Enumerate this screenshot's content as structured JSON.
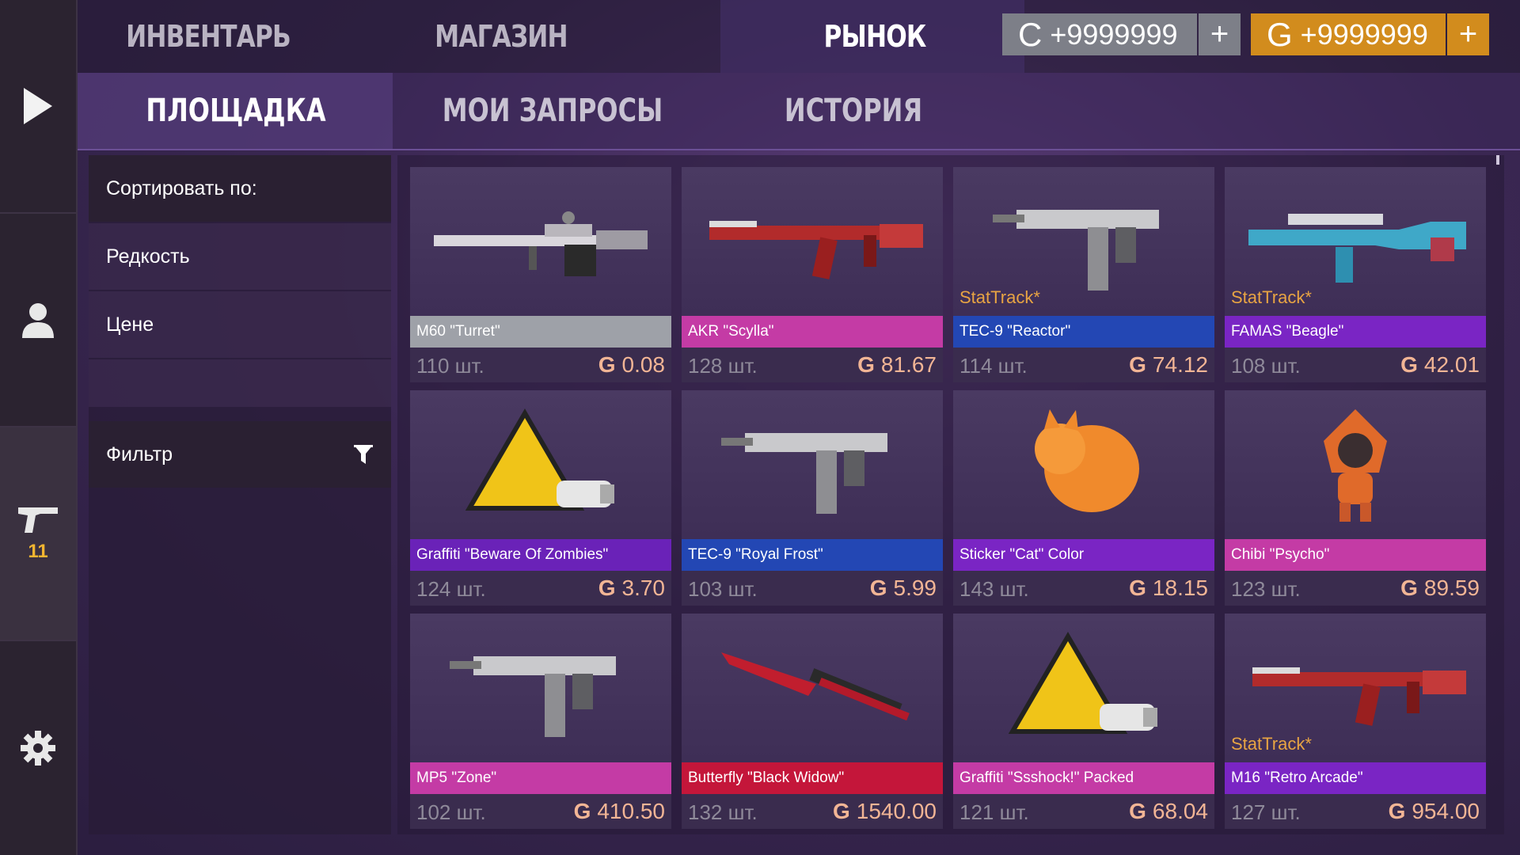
{
  "rail": {
    "weapon_count": "11"
  },
  "top_tabs": [
    {
      "label": "ИНВЕНТАРЬ"
    },
    {
      "label": "МАГАЗИН"
    },
    {
      "label": "РЫНОК"
    }
  ],
  "currency": {
    "credits": {
      "symbol": "C",
      "amount": "+9999999",
      "plus": "+",
      "color": "#7d7f88"
    },
    "gold": {
      "symbol": "G",
      "amount": "+9999999",
      "plus": "+",
      "color": "#d28c1d"
    }
  },
  "sub_tabs": [
    {
      "label": "ПЛОЩАДКА"
    },
    {
      "label": "МОИ ЗАПРОСЫ"
    },
    {
      "label": "ИСТОРИЯ"
    }
  ],
  "sort": {
    "header": "Сортировать по:",
    "options": [
      "Редкость",
      "Цене"
    ],
    "filter_label": "Фильтр"
  },
  "items": [
    {
      "name": "M60 \"Turret\"",
      "qty": "110 шт.",
      "currency": "G",
      "price": "0.08",
      "stattrak": "",
      "rarity_color": "#9ea1a8",
      "icon": "machine-gun-icon"
    },
    {
      "name": "AKR \"Scylla\"",
      "qty": "128 шт.",
      "currency": "G",
      "price": "81.67",
      "stattrak": "",
      "rarity_color": "#c43ba5",
      "icon": "rifle-icon"
    },
    {
      "name": "TEC-9 \"Reactor\"",
      "qty": "114 шт.",
      "currency": "G",
      "price": "74.12",
      "stattrak": "StatTrack*",
      "rarity_color": "#2347b4",
      "icon": "smg-icon"
    },
    {
      "name": "FAMAS \"Beagle\"",
      "qty": "108 шт.",
      "currency": "G",
      "price": "42.01",
      "stattrak": "StatTrack*",
      "rarity_color": "#7a25c4",
      "icon": "bullpup-rifle-icon"
    },
    {
      "name": "Graffiti \"Beware Of Zombies\"",
      "qty": "124 шт.",
      "currency": "G",
      "price": "3.70",
      "stattrak": "",
      "rarity_color": "#6a22b8",
      "icon": "graffiti-icon"
    },
    {
      "name": "TEC-9 \"Royal Frost\"",
      "qty": "103 шт.",
      "currency": "G",
      "price": "5.99",
      "stattrak": "",
      "rarity_color": "#2347b4",
      "icon": "smg-icon"
    },
    {
      "name": "Sticker \"Cat\" Color",
      "qty": "143 шт.",
      "currency": "G",
      "price": "18.15",
      "stattrak": "",
      "rarity_color": "#7a25c4",
      "icon": "sticker-icon"
    },
    {
      "name": "Chibi \"Psycho\"",
      "qty": "123 шт.",
      "currency": "G",
      "price": "89.59",
      "stattrak": "",
      "rarity_color": "#c43ba5",
      "icon": "chibi-figure-icon"
    },
    {
      "name": "MP5 \"Zone\"",
      "qty": "102 шт.",
      "currency": "G",
      "price": "410.50",
      "stattrak": "",
      "rarity_color": "#c43ba5",
      "icon": "smg-icon"
    },
    {
      "name": "Butterfly \"Black Widow\"",
      "qty": "132 шт.",
      "currency": "G",
      "price": "1540.00",
      "stattrak": "",
      "rarity_color": "#c4163a",
      "icon": "knife-icon"
    },
    {
      "name": "Graffiti \"Ssshock!\" Packed",
      "qty": "121 шт.",
      "currency": "G",
      "price": "68.04",
      "stattrak": "",
      "rarity_color": "#c43ba5",
      "icon": "graffiti-icon"
    },
    {
      "name": "M16 \"Retro Arcade\"",
      "qty": "127 шт.",
      "currency": "G",
      "price": "954.00",
      "stattrak": "StatTrack*",
      "rarity_color": "#7a25c4",
      "icon": "rifle-icon"
    }
  ]
}
